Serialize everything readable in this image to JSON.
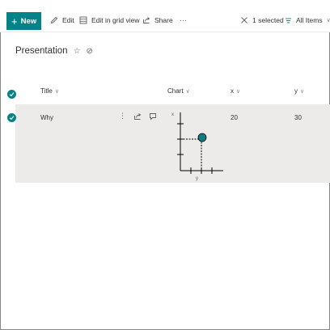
{
  "toolbar": {
    "new_label": "New",
    "edit_label": "Edit",
    "grid_label": "Edit in grid view",
    "share_label": "Share",
    "more_label": "⋯",
    "selected_label": "1 selected",
    "view_label": "All Items"
  },
  "list": {
    "title": "Presentation"
  },
  "columns": {
    "title": "Title",
    "chart": "Chart",
    "x": "x",
    "y": "y"
  },
  "rows": [
    {
      "title": "Why",
      "x": "20",
      "y": "30"
    }
  ],
  "mini_chart": {
    "x_axis_label": "x",
    "y_axis_label": "y"
  },
  "colors": {
    "accent": "#038387",
    "selected_row": "#edebe9",
    "point": "#0e7c86"
  },
  "icons": [
    "plus-icon",
    "pencil-icon",
    "grid-icon",
    "share-icon",
    "more-icon",
    "close-icon",
    "filter-icon",
    "chevron-down-icon",
    "star-icon",
    "circle-check-icon",
    "comment-icon"
  ]
}
